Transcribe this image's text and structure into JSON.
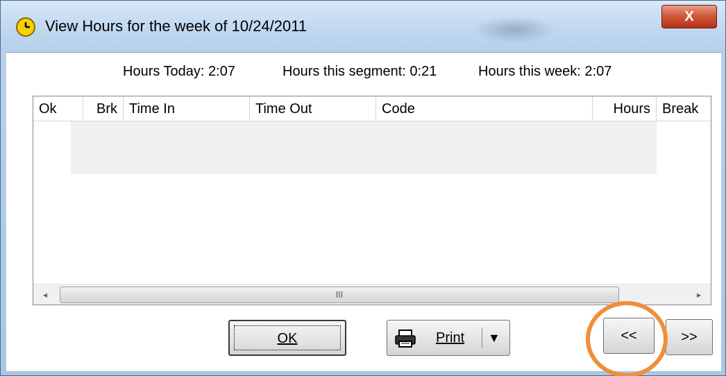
{
  "window": {
    "title": "View Hours for the week of 10/24/2011",
    "close_label": "X",
    "title_icon": "clock-icon"
  },
  "stats": {
    "today": "Hours Today: 2:07",
    "segment": "Hours this segment: 0:21",
    "week": "Hours this week: 2:07"
  },
  "list": {
    "columns": [
      "Ok",
      "Brk",
      "Time In",
      "Time Out",
      "Code",
      "Hours",
      "Break"
    ],
    "rows": []
  },
  "scrollbar": {
    "left_arrow": "◂",
    "right_arrow": "▸",
    "grip": "III"
  },
  "buttons": {
    "ok_label": "OK",
    "print_label": "Print",
    "print_dropdown": "▼",
    "prev_label": "<<",
    "next_label": ">>"
  },
  "colors": {
    "highlight": "#ee8f3a",
    "close_button": "#c7402a"
  }
}
